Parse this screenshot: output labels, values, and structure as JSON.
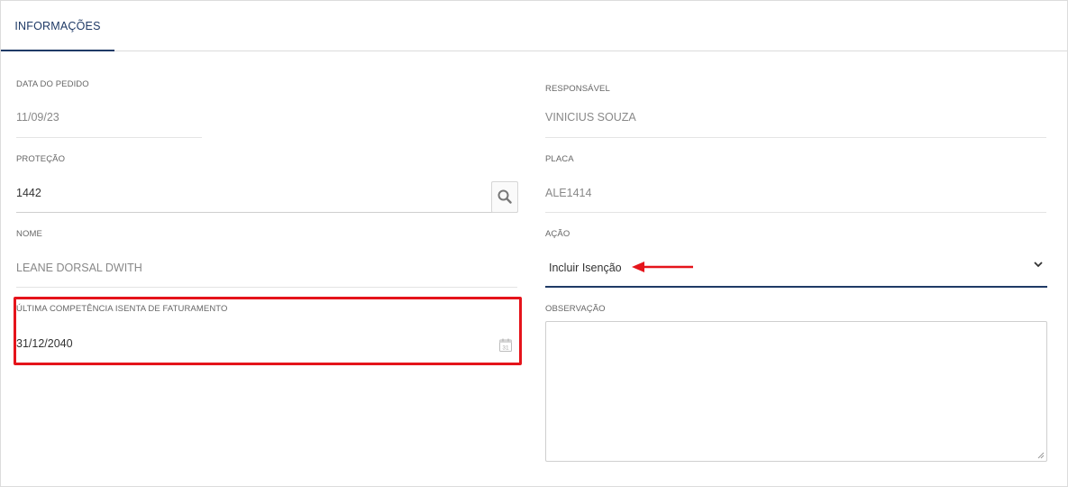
{
  "tabs": [
    {
      "label": "INFORMAÇÕES",
      "active": true
    }
  ],
  "form": {
    "data_do_pedido": {
      "label": "DATA DO PEDIDO",
      "value": "11/09/23"
    },
    "responsavel": {
      "label": "RESPONSÁVEL",
      "value": "VINICIUS SOUZA"
    },
    "protecao": {
      "label": "PROTEÇÃO",
      "value": "1442"
    },
    "placa": {
      "label": "PLACA",
      "value": "ALE1414"
    },
    "nome": {
      "label": "NOME",
      "value": "LEANE DORSAL DWITH"
    },
    "acao": {
      "label": "AÇÃO",
      "value": "Incluir Isenção"
    },
    "ultima_competencia": {
      "label": "ÚLTIMA COMPETÊNCIA ISENTA DE FATURAMENTO",
      "value": "31/12/2040"
    },
    "observacao": {
      "label": "OBSERVAÇÃO",
      "value": ""
    }
  },
  "icons": {
    "search": "search-icon",
    "calendar": "calendar-icon",
    "chevron": "chevron-down-icon"
  },
  "colors": {
    "accent": "#1f3a66",
    "highlight": "#e5141b"
  }
}
